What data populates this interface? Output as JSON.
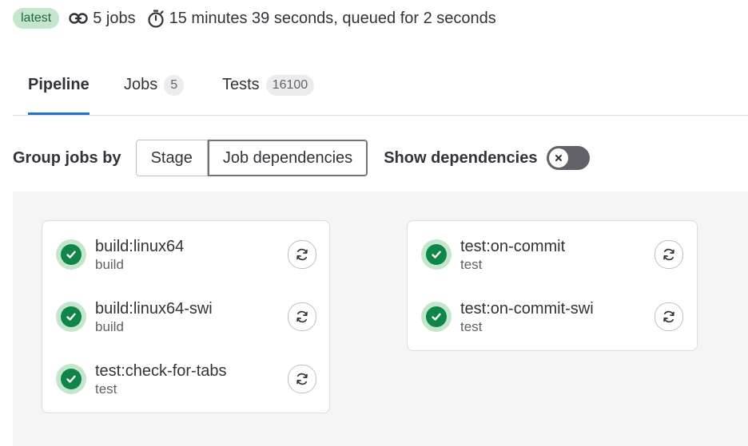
{
  "header": {
    "badge": "latest",
    "jobs_text": "5 jobs",
    "duration_text": "15 minutes 39 seconds, queued for 2 seconds"
  },
  "tabs": [
    {
      "label": "Pipeline",
      "count": null,
      "active": true
    },
    {
      "label": "Jobs",
      "count": "5",
      "active": false
    },
    {
      "label": "Tests",
      "count": "16100",
      "active": false
    }
  ],
  "controls": {
    "group_label": "Group jobs by",
    "options": [
      "Stage",
      "Job dependencies"
    ],
    "selected": "Job dependencies",
    "show_dependencies_label": "Show dependencies",
    "show_dependencies_on": false
  },
  "groups": [
    {
      "jobs": [
        {
          "name": "build:linux64",
          "stage": "build",
          "status": "passed"
        },
        {
          "name": "build:linux64-swi",
          "stage": "build",
          "status": "passed"
        },
        {
          "name": "test:check-for-tabs",
          "stage": "test",
          "status": "passed"
        }
      ]
    },
    {
      "jobs": [
        {
          "name": "test:on-commit",
          "stage": "test",
          "status": "passed"
        },
        {
          "name": "test:on-commit-swi",
          "stage": "test",
          "status": "passed"
        }
      ]
    }
  ],
  "icons": {
    "jobs": "pipeline-link-icon",
    "duration": "stopwatch-icon",
    "status": "check-circle-icon",
    "retry": "retry-icon",
    "toggle": "close-icon"
  },
  "colors": {
    "accent": "#1f75cb",
    "success": "#108548",
    "success_bg": "#c3e6cd",
    "toggle_off": "#626168"
  }
}
